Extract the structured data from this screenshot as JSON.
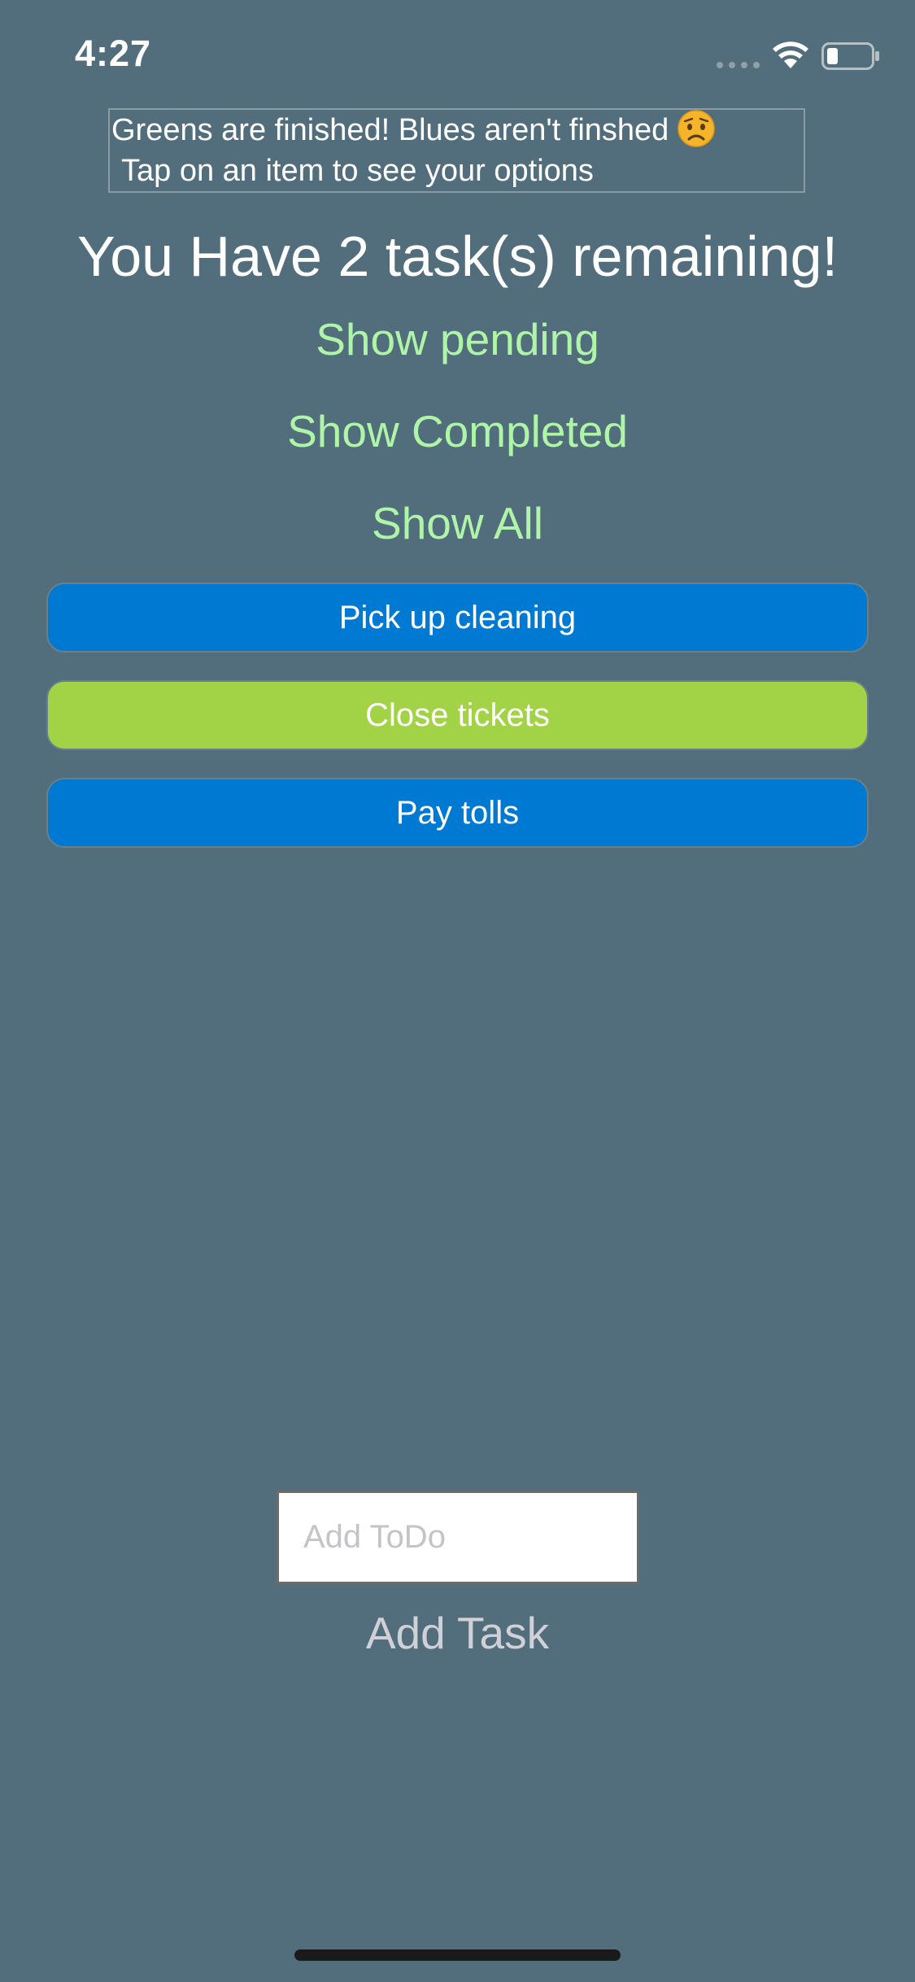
{
  "status_bar": {
    "time": "4:27",
    "icons": [
      "signal-dots-icon",
      "wifi-icon",
      "battery-icon"
    ]
  },
  "info": {
    "line1": "Greens are finished! Blues aren't finshed",
    "emoji_icon": "worried-face-icon",
    "line2": "Tap on an item to see your options"
  },
  "heading": "You Have 2 task(s) remaining!",
  "filters": {
    "pending": "Show pending",
    "completed": "Show Completed",
    "all": "Show All"
  },
  "tasks": [
    {
      "label": "Pick up cleaning",
      "status": "pending"
    },
    {
      "label": "Close tickets",
      "status": "completed"
    },
    {
      "label": "Pay tolls",
      "status": "pending"
    }
  ],
  "input": {
    "placeholder": "Add ToDo",
    "value": ""
  },
  "add_task_label": "Add Task",
  "colors": {
    "background": "#526e7d",
    "pending": "#0079d3",
    "completed": "#a2d246",
    "filter_link": "#aff5a7"
  }
}
